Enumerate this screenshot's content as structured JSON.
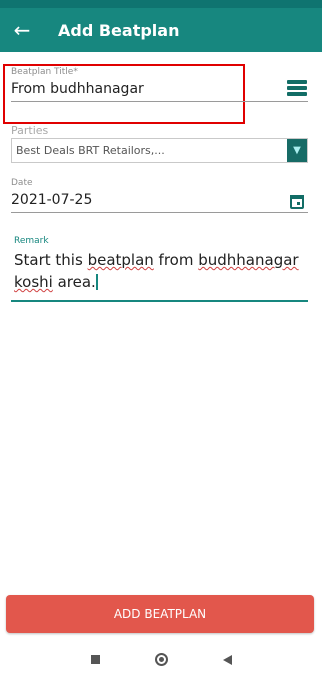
{
  "header": {
    "title": "Add Beatplan",
    "back_icon": "arrow-left-icon"
  },
  "form": {
    "beatplan_title": {
      "label": "Beatplan Title*",
      "value": "From budhhanagar",
      "icon": "list-menu-icon"
    },
    "parties": {
      "label": "Parties",
      "value": "Best Deals BRT Retailors,...",
      "icon": "chevron-down-icon"
    },
    "date": {
      "label": "Date",
      "value": "2021-07-25",
      "icon": "calendar-icon"
    },
    "remark": {
      "label": "Remark",
      "text_parts": [
        "Start this ",
        "beatplan",
        " from ",
        "budhhanagar",
        " ",
        "koshi",
        " area."
      ]
    }
  },
  "actions": {
    "add_label": "ADD BEATPLAN"
  },
  "colors": {
    "primary": "#17877f",
    "accent_button": "#e2574c",
    "highlight_border": "#e00000"
  },
  "nav": {
    "icons": [
      "recents-square-icon",
      "home-circle-icon",
      "back-triangle-icon"
    ]
  }
}
